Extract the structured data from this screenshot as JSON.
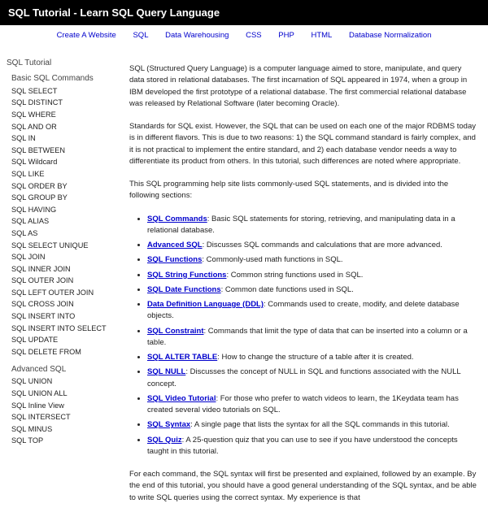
{
  "header": {
    "title": "SQL Tutorial - Learn SQL Query Language"
  },
  "topnav": [
    "Create A Website",
    "SQL",
    "Data Warehousing",
    "CSS",
    "PHP",
    "HTML",
    "Database Normalization"
  ],
  "sidebar": {
    "title": "SQL Tutorial",
    "sections": [
      {
        "heading": "Basic SQL Commands",
        "items": [
          "SQL SELECT",
          "SQL DISTINCT",
          "SQL WHERE",
          "SQL AND OR",
          "SQL IN",
          "SQL BETWEEN",
          "SQL Wildcard",
          "SQL LIKE",
          "SQL ORDER BY",
          "SQL GROUP BY",
          "SQL HAVING",
          "SQL ALIAS",
          "SQL AS",
          "SQL SELECT UNIQUE",
          "SQL JOIN",
          "SQL INNER JOIN",
          "SQL OUTER JOIN",
          "SQL LEFT OUTER JOIN",
          "SQL CROSS JOIN",
          "SQL INSERT INTO",
          "SQL INSERT INTO SELECT",
          "SQL UPDATE",
          "SQL DELETE FROM"
        ]
      },
      {
        "heading": "Advanced SQL",
        "items": [
          "SQL UNION",
          "SQL UNION ALL",
          "SQL Inline View",
          "SQL INTERSECT",
          "SQL MINUS",
          "SQL TOP"
        ]
      }
    ]
  },
  "main": {
    "p1": "SQL (Structured Query Language) is a computer language aimed to store, manipulate, and query data stored in relational databases. The first incarnation of SQL appeared in 1974, when a group in IBM developed the first prototype of a relational database. The first commercial relational database was released by Relational Software (later becoming Oracle).",
    "p2": "Standards for SQL exist. However, the SQL that can be used on each one of the major RDBMS today is in different flavors. This is due to two reasons: 1) the SQL command standard is fairly complex, and it is not practical to implement the entire standard, and 2) each database vendor needs a way to differentiate its product from others. In this tutorial, such differences are noted where appropriate.",
    "p3": "This SQL programming help site lists commonly-used SQL statements, and is divided into the following sections:",
    "bullets": [
      {
        "link": "SQL Commands",
        "text": ": Basic SQL statements for storing, retrieving, and manipulating data in a relational database."
      },
      {
        "link": "Advanced SQL",
        "text": ": Discusses SQL commands and calculations that are more advanced."
      },
      {
        "link": "SQL Functions",
        "text": ": Commonly-used math functions in SQL."
      },
      {
        "link": "SQL String Functions",
        "text": ": Common string functions used in SQL."
      },
      {
        "link": "SQL Date Functions",
        "text": ": Common date functions used in SQL."
      },
      {
        "link": "Data Definition Language (DDL)",
        "text": ": Commands used to create, modify, and delete database objects."
      },
      {
        "link": "SQL Constraint",
        "text": ": Commands that limit the type of data that can be inserted into a column or a table."
      },
      {
        "link": "SQL ALTER TABLE",
        "text": ": How to change the structure of a table after it is created."
      },
      {
        "link": "SQL NULL",
        "text": ": Discusses the concept of NULL in SQL and functions associated with the NULL concept."
      },
      {
        "link": "SQL Video Tutorial",
        "text": ": For those who prefer to watch videos to learn, the 1Keydata team has created several video tutorials on SQL."
      },
      {
        "link": "SQL Syntax",
        "text": ": A single page that lists the syntax for all the SQL commands in this tutorial."
      },
      {
        "link": "SQL Quiz",
        "text": ": A 25-question quiz that you can use to see if you have understood the concepts taught in this tutorial."
      }
    ],
    "p4": "For each command, the SQL syntax will first be presented and explained, followed by an example. By the end of this tutorial, you should have a good general understanding of the SQL syntax, and be able to write SQL queries using the correct syntax. My experience is that"
  }
}
